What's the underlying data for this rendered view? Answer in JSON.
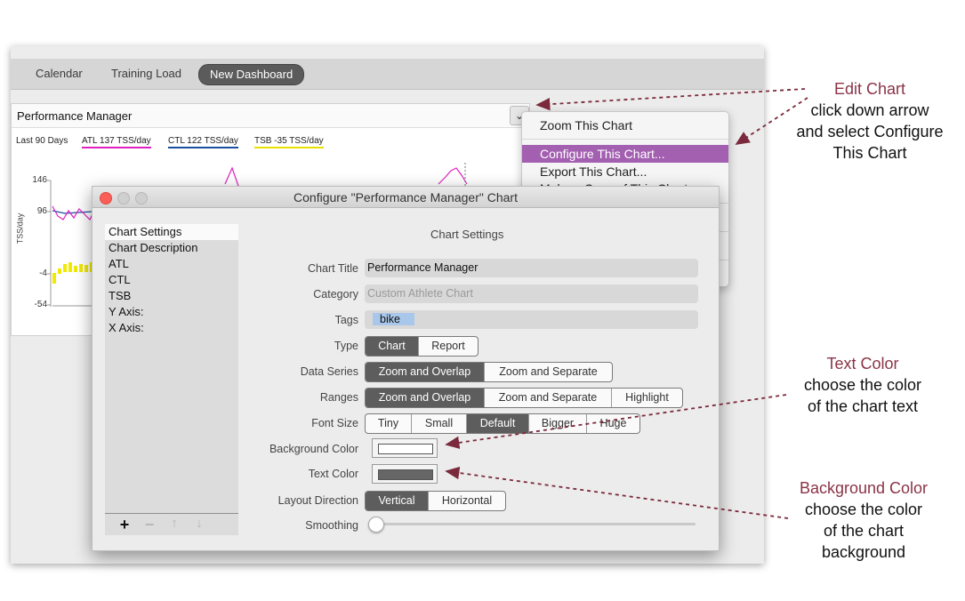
{
  "tabs": [
    "Calendar",
    "Training Load",
    "New Dashboard"
  ],
  "chart": {
    "title": "Performance Manager",
    "dropdown_icon": "chevron-down-icon",
    "period": "Last 90 Days",
    "legend": [
      {
        "label": "ATL 137 TSS/day",
        "color": "#e020c0"
      },
      {
        "label": "CTL 122 TSS/day",
        "color": "#1a4fa0"
      },
      {
        "label": "TSB -35 TSS/day",
        "color": "#e8e000"
      }
    ],
    "y_ticks": [
      "146",
      "96",
      "-4",
      "-54"
    ],
    "y_axis_label": "TSS/day"
  },
  "menu": {
    "items": [
      "Zoom This Chart",
      "Configure This Chart...",
      "Export This Chart...",
      "Make a Copy of This Chart"
    ]
  },
  "dialog": {
    "title": "Configure \"Performance Manager\" Chart",
    "sidebar_items": [
      "Chart Settings",
      "Chart Description",
      "ATL",
      "CTL",
      "TSB",
      "Y Axis:",
      "X Axis:"
    ],
    "section_title": "Chart Settings",
    "labels": {
      "chart_title": "Chart Title",
      "category": "Category",
      "tags": "Tags",
      "type": "Type",
      "data_series": "Data Series",
      "ranges": "Ranges",
      "font_size": "Font Size",
      "background_color": "Background Color",
      "text_color": "Text Color",
      "layout_direction": "Layout Direction",
      "smoothing": "Smoothing"
    },
    "chart_title_value": "Performance Manager",
    "category_placeholder": "Custom Athlete Chart",
    "tag": "bike",
    "type_options": [
      "Chart",
      "Report"
    ],
    "data_series_options": [
      "Zoom and Overlap",
      "Zoom and Separate"
    ],
    "ranges_options": [
      "Zoom and Overlap",
      "Zoom and Separate",
      "Highlight"
    ],
    "font_size_options": [
      "Tiny",
      "Small",
      "Default",
      "Bigger",
      "Huge"
    ],
    "layout_options": [
      "Vertical",
      "Horizontal"
    ],
    "background_color": "#ffffff",
    "text_color": "#666666"
  },
  "annotations": {
    "edit_chart": {
      "heading": "Edit Chart",
      "lines": [
        "click down arrow",
        "and select Configure",
        "This Chart"
      ]
    },
    "text_color": {
      "heading": "Text Color",
      "lines": [
        "choose the color",
        "of the chart text"
      ]
    },
    "background_color": {
      "heading": "Background Color",
      "lines": [
        "choose the color",
        "of the chart",
        "background"
      ]
    }
  }
}
